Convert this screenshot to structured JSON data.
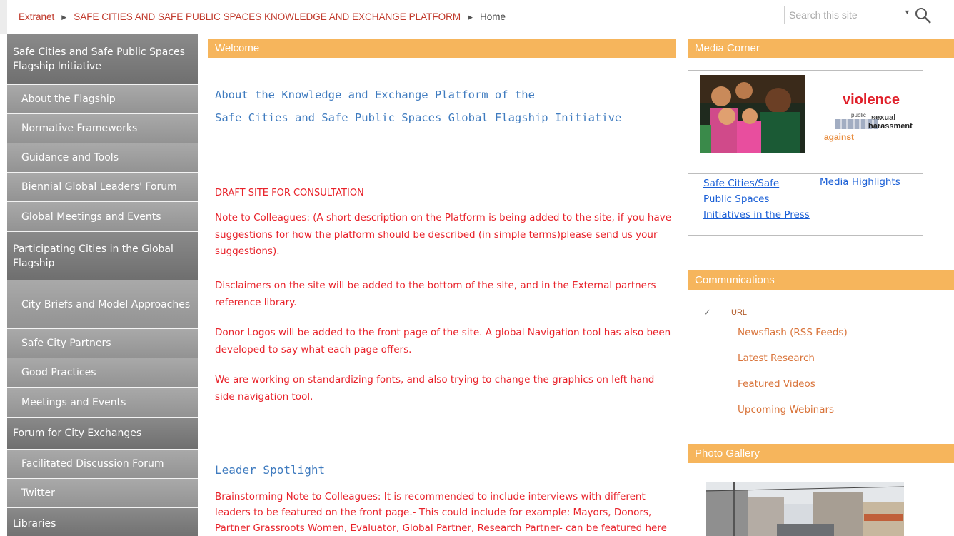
{
  "breadcrumb": {
    "items": [
      "Extranet",
      "SAFE CITIES AND SAFE PUBLIC SPACES KNOWLEDGE AND EXCHANGE PLATFORM"
    ],
    "current": "Home"
  },
  "search": {
    "placeholder": "Search this site"
  },
  "leftnav": {
    "items": [
      {
        "label": "Safe Cities and Safe Public Spaces Flagship Initiative",
        "level": "head"
      },
      {
        "label": "About the Flagship",
        "level": "sub"
      },
      {
        "label": "Normative Frameworks",
        "level": "sub"
      },
      {
        "label": "Guidance and Tools",
        "level": "sub"
      },
      {
        "label": "Biennial Global Leaders' Forum",
        "level": "sub"
      },
      {
        "label": "Global Meetings and Events",
        "level": "sub"
      },
      {
        "label": "Participating Cities in the Global Flagship",
        "level": "head"
      },
      {
        "label": "City Briefs and Model Approaches",
        "level": "sub"
      },
      {
        "label": "Safe City Partners",
        "level": "sub"
      },
      {
        "label": "Good Practices",
        "level": "sub"
      },
      {
        "label": "Meetings and Events",
        "level": "sub"
      },
      {
        "label": "Forum for City Exchanges",
        "level": "head"
      },
      {
        "label": "Facilitated Discussion Forum",
        "level": "sub"
      },
      {
        "label": "Twitter",
        "level": "sub"
      },
      {
        "label": "Libraries",
        "level": "head"
      }
    ]
  },
  "main": {
    "welcome_header": "Welcome",
    "title_line1": "About the Knowledge and Exchange Platform of the",
    "title_line2": "Safe Cities and Safe Public Spaces Global Flagship Initiative",
    "draft_label": "DRAFT SITE FOR CONSULTATION",
    "note1": "Note to Colleagues: (A short description on the Platform is being added to the site, if you have suggestions for how the platform should be described  (in simple terms)please send us your suggestions).",
    "note2": "Disclaimers on the site will be  added to the bottom of the site, and in the External partners reference library.",
    "note3": "Donor Logos will be added to the front page of the site. A global Navigation tool has also been developed to say what each page offers.",
    "note4": "We are working on standardizing fonts, and also trying to change the graphics on left hand side navigation tool.",
    "spotlight_title": "Leader Spotlight",
    "spotlight_text": "Brainstorming Note to Colleagues: It is recommended to include interviews with different leaders to be featured on the front page.- This could include for example: Mayors, Donors, Partner Grassroots Women, Evaluator, Global Partner, Research Partner- can be featured here by engaging our offices."
  },
  "media_corner": {
    "header": "Media Corner",
    "link1": "Safe Cities/Safe Public Spaces  Initiatives in the Press",
    "link2": "Media Highlights",
    "word_cloud": {
      "w1": "violence",
      "w2": "public",
      "w3": "sexual",
      "w4": "harassment",
      "w5": "against"
    }
  },
  "communications": {
    "header": "Communications",
    "check_icon": "✓",
    "url_label": "URL",
    "links": [
      "Newsflash (RSS Feeds)",
      "Latest Research",
      "Featured Videos",
      "Upcoming Webinars"
    ]
  },
  "photo_gallery": {
    "header": "Photo Gallery"
  },
  "colors": {
    "accent_orange": "#f6b55c",
    "nav_gray": "#939393",
    "alert_red": "#e8222a",
    "title_blue": "#3f7bbf",
    "link_blue": "#1a5fd6",
    "comm_orange": "#d9743b"
  }
}
